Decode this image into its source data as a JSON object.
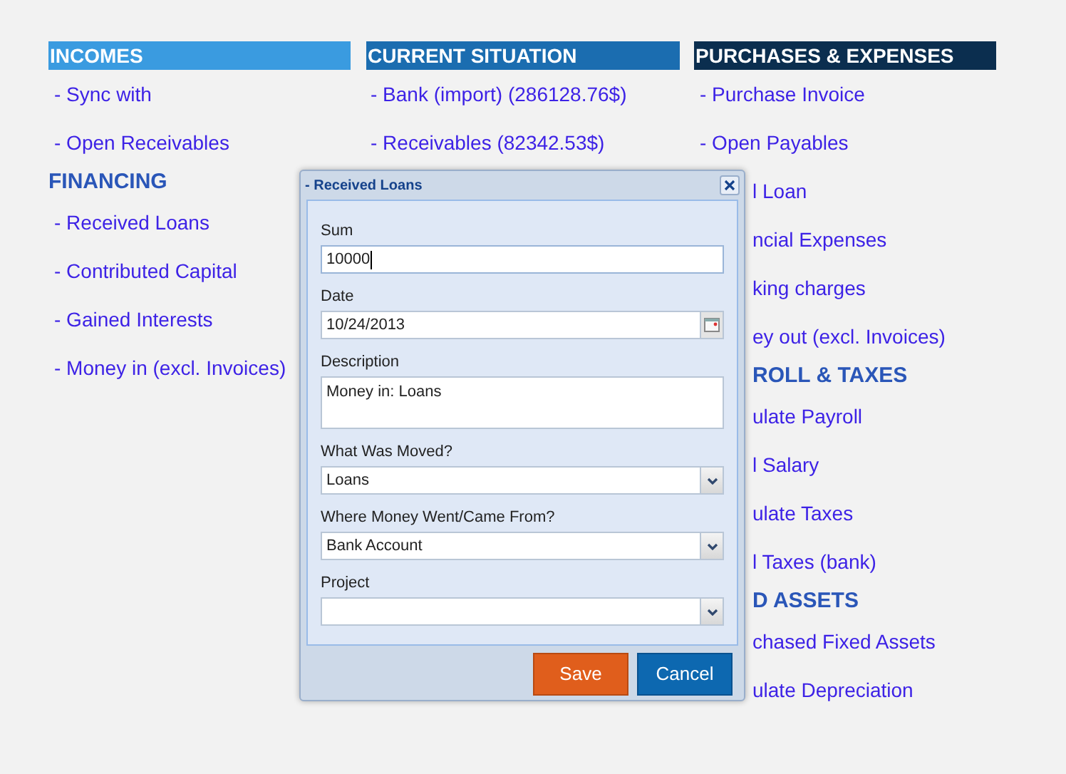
{
  "columns": [
    {
      "heading": "INCOMES",
      "color": "#3a9be0",
      "items": [
        {
          "kind": "link",
          "text": "- Sync with"
        },
        {
          "kind": "link",
          "text": "- Open Receivables"
        },
        {
          "kind": "subheading",
          "text": "FINANCING"
        },
        {
          "kind": "link",
          "text": "- Received Loans"
        },
        {
          "kind": "link",
          "text": "- Contributed Capital"
        },
        {
          "kind": "link",
          "text": "- Gained Interests"
        },
        {
          "kind": "link",
          "text": "- Money in (excl. Invoices)"
        }
      ]
    },
    {
      "heading": "CURRENT SITUATION",
      "color": "#1b6db0",
      "items": [
        {
          "kind": "link",
          "text": "- Bank (import) (286128.76$)"
        },
        {
          "kind": "link",
          "text": "- Receivables (82342.53$)"
        }
      ]
    },
    {
      "heading": "PURCHASES & EXPENSES",
      "color": "#0b2e4f",
      "items": [
        {
          "kind": "link",
          "text": "- Purchase Invoice"
        },
        {
          "kind": "link",
          "text": "- Open Payables"
        },
        {
          "kind": "partial_link",
          "text": "l Loan"
        },
        {
          "kind": "partial_link",
          "text": "ncial Expenses"
        },
        {
          "kind": "partial_link",
          "text": "king charges"
        },
        {
          "kind": "partial_link",
          "text": "ey out (excl. Invoices)"
        },
        {
          "kind": "partial_subheading",
          "text": "ROLL & TAXES"
        },
        {
          "kind": "partial_link",
          "text": "ulate Payroll"
        },
        {
          "kind": "partial_link",
          "text": "l Salary"
        },
        {
          "kind": "partial_link",
          "text": "ulate Taxes"
        },
        {
          "kind": "partial_link",
          "text": "l Taxes (bank)"
        },
        {
          "kind": "partial_subheading",
          "text": "D ASSETS"
        },
        {
          "kind": "partial_link",
          "text": "chased Fixed Assets"
        },
        {
          "kind": "partial_link",
          "text": "ulate Depreciation"
        }
      ]
    }
  ],
  "dialog": {
    "title": "- Received Loans",
    "fields": [
      {
        "kind": "text",
        "label": "Sum",
        "value": "10000"
      },
      {
        "kind": "date",
        "label": "Date",
        "value": "10/24/2013"
      },
      {
        "kind": "textarea",
        "label": "Description",
        "value": "Money in: Loans"
      },
      {
        "kind": "select",
        "label": "What Was Moved?",
        "value": "Loans"
      },
      {
        "kind": "select",
        "label": "Where Money Went/Came From?",
        "value": "Bank Account"
      },
      {
        "kind": "select",
        "label": "Project"
      }
    ],
    "buttons": [
      {
        "kind": "primary",
        "label": "Save"
      },
      {
        "kind": "secondary",
        "label": "Cancel"
      }
    ]
  }
}
